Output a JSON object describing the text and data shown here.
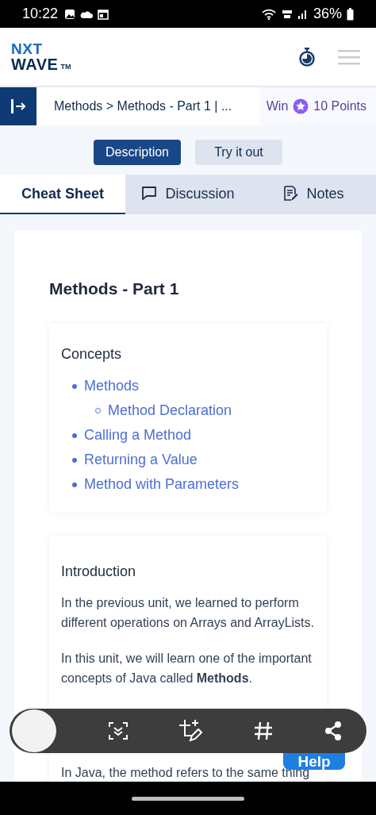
{
  "status_bar": {
    "time": "10:22",
    "battery": "36%"
  },
  "header": {
    "logo_line_1": "NXT",
    "logo_line_2": "WAVE",
    "logo_mark": "TM"
  },
  "breadcrumb": {
    "text": "Methods > Methods - Part 1 | ...",
    "reward_prefix": "Win",
    "reward_points": "10 Points"
  },
  "mode_buttons": [
    {
      "label": "Description",
      "selected": true
    },
    {
      "label": "Try it out",
      "selected": false
    }
  ],
  "tabs": [
    {
      "label": "Cheat Sheet",
      "selected": true
    },
    {
      "label": "Discussion",
      "selected": false
    },
    {
      "label": "Notes",
      "selected": false
    }
  ],
  "content": {
    "title": "Methods - Part 1",
    "concepts": {
      "heading": "Concepts",
      "items": [
        {
          "label": "Methods",
          "children": [
            {
              "label": "Method Declaration"
            }
          ]
        },
        {
          "label": "Calling a Method"
        },
        {
          "label": "Returning a Value"
        },
        {
          "label": "Method with Parameters"
        }
      ]
    },
    "introduction": {
      "heading": "Introduction",
      "paragraphs": [
        "In the previous unit, we learned to perform different operations on Arrays and ArrayLists.",
        "In this unit, we will learn one of the important concepts of Java called **Methods**."
      ],
      "paragraph_after": "In Java, the method refers to the same thing"
    }
  },
  "help_button": {
    "label": "Help"
  }
}
